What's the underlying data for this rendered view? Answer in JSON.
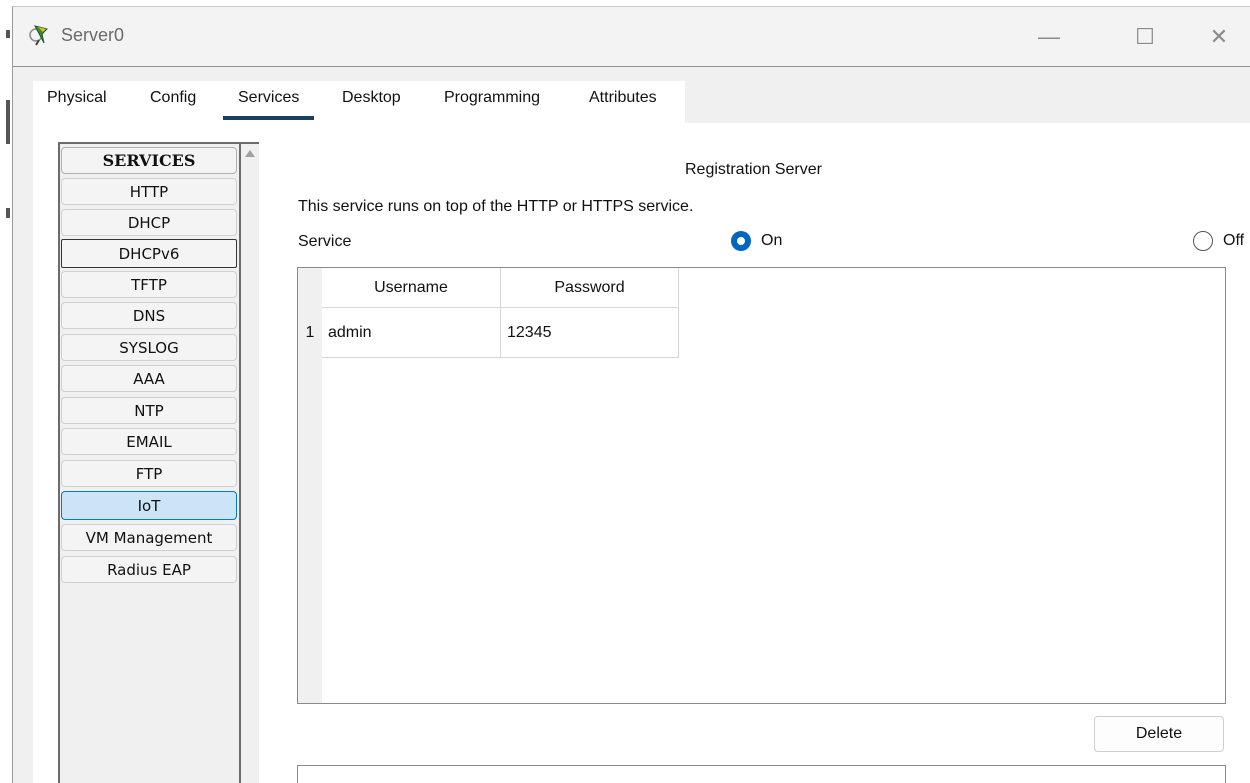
{
  "window": {
    "title": "Server0",
    "minimize_icon": "—",
    "maximize_icon": "☐",
    "close_icon": "✕"
  },
  "tabs": [
    {
      "label": "Physical"
    },
    {
      "label": "Config"
    },
    {
      "label": "Services",
      "active": true
    },
    {
      "label": "Desktop"
    },
    {
      "label": "Programming"
    },
    {
      "label": "Attributes"
    }
  ],
  "services": {
    "header": "SERVICES",
    "items": [
      {
        "label": "HTTP"
      },
      {
        "label": "DHCP"
      },
      {
        "label": "DHCPv6"
      },
      {
        "label": "TFTP"
      },
      {
        "label": "DNS"
      },
      {
        "label": "SYSLOG"
      },
      {
        "label": "AAA"
      },
      {
        "label": "NTP"
      },
      {
        "label": "EMAIL"
      },
      {
        "label": "FTP"
      },
      {
        "label": "IoT"
      },
      {
        "label": "VM Management"
      },
      {
        "label": "Radius EAP"
      }
    ],
    "selected": "DHCPv6",
    "highlighted": "IoT"
  },
  "panel": {
    "title": "Registration Server",
    "description": "This service runs on top of the HTTP or HTTPS service.",
    "service_label": "Service",
    "on_label": "On",
    "off_label": "Off",
    "service_state": "On"
  },
  "table": {
    "columns": [
      "Username",
      "Password"
    ],
    "rows": [
      {
        "num": "1",
        "username": "admin",
        "password": "12345"
      }
    ]
  },
  "actions": {
    "delete_label": "Delete"
  },
  "colors": {
    "accent": "#0067c0",
    "tab_underline": "#1a3e66",
    "highlight": "#cce4f7"
  }
}
